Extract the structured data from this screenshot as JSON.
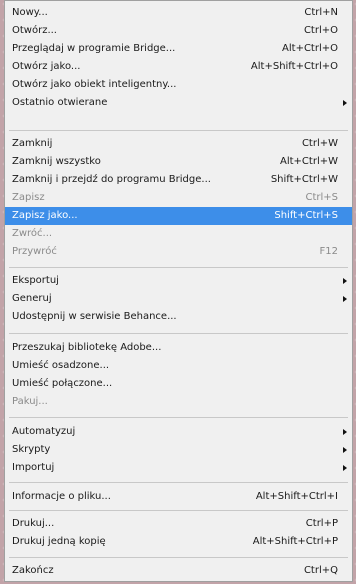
{
  "menu": {
    "items": [
      {
        "label": "Nowy...",
        "shortcut": "Ctrl+N"
      },
      {
        "label": "Otwórz...",
        "shortcut": "Ctrl+O"
      },
      {
        "label": "Przeglądaj w programie Bridge...",
        "shortcut": "Alt+Ctrl+O"
      },
      {
        "label": "Otwórz jako...",
        "shortcut": "Alt+Shift+Ctrl+O"
      },
      {
        "label": "Otwórz jako obiekt inteligentny..."
      },
      {
        "label": "Ostatnio otwierane",
        "submenu": true
      },
      {
        "label": "Zamknij",
        "shortcut": "Ctrl+W"
      },
      {
        "label": "Zamknij wszystko",
        "shortcut": "Alt+Ctrl+W"
      },
      {
        "label": "Zamknij i przejdź do programu Bridge...",
        "shortcut": "Shift+Ctrl+W"
      },
      {
        "label": "Zapisz",
        "shortcut": "Ctrl+S",
        "disabled": true
      },
      {
        "label": "Zapisz jako...",
        "shortcut": "Shift+Ctrl+S",
        "highlighted": true
      },
      {
        "label": "Zwróć...",
        "disabled": true
      },
      {
        "label": "Przywróć",
        "shortcut": "F12",
        "disabled": true
      },
      {
        "label": "Eksportuj",
        "submenu": true
      },
      {
        "label": "Generuj",
        "submenu": true
      },
      {
        "label": "Udostępnij w serwisie Behance..."
      },
      {
        "label": "Przeszukaj bibliotekę Adobe..."
      },
      {
        "label": "Umieść osadzone..."
      },
      {
        "label": "Umieść połączone..."
      },
      {
        "label": "Pakuj...",
        "disabled": true
      },
      {
        "label": "Automatyzuj",
        "submenu": true
      },
      {
        "label": "Skrypty",
        "submenu": true
      },
      {
        "label": "Importuj",
        "submenu": true
      },
      {
        "label": "Informacje o pliku...",
        "shortcut": "Alt+Shift+Ctrl+I"
      },
      {
        "label": "Drukuj...",
        "shortcut": "Ctrl+P"
      },
      {
        "label": "Drukuj jedną kopię",
        "shortcut": "Alt+Shift+Ctrl+P"
      },
      {
        "label": "Zakończ",
        "shortcut": "Ctrl+Q"
      }
    ],
    "highlight_color": "#3d8ee9",
    "disabled_color": "#8a8a8a"
  }
}
